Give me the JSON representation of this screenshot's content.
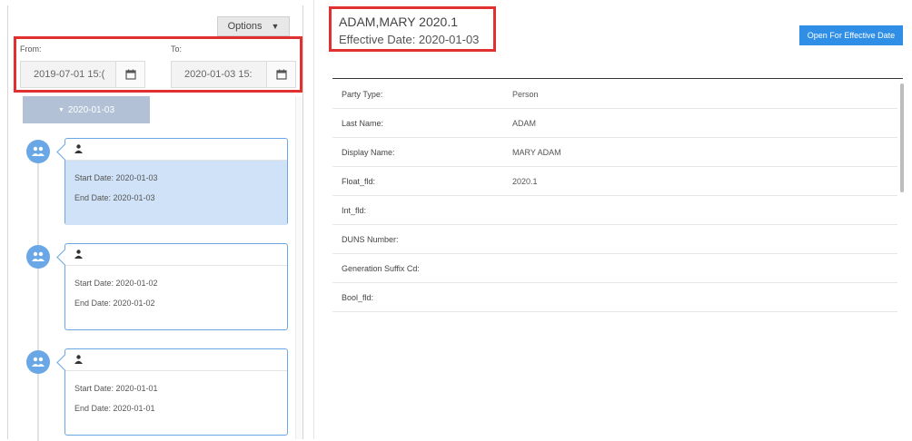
{
  "left": {
    "options_label": "Options",
    "from_label": "From:",
    "to_label": "To:",
    "from_value": "2019-07-01 15:(",
    "to_value": "2020-01-03 15:",
    "group_label": "2020-01-03",
    "cards": [
      {
        "start": "Start Date: 2020-01-03",
        "end": "End Date: 2020-01-03",
        "selected": true
      },
      {
        "start": "Start Date: 2020-01-02",
        "end": "End Date: 2020-01-02",
        "selected": false
      },
      {
        "start": "Start Date: 2020-01-01",
        "end": "End Date: 2020-01-01",
        "selected": false
      }
    ]
  },
  "header": {
    "title": "ADAM,MARY 2020.1",
    "effective": "Effective Date:  2020-01-03",
    "open_button": "Open For Effective Date"
  },
  "fields": [
    {
      "label": "Party Type:",
      "value": "Person"
    },
    {
      "label": "Last Name:",
      "value": "ADAM"
    },
    {
      "label": "Display Name:",
      "value": "MARY ADAM"
    },
    {
      "label": "Float_fld:",
      "value": "2020.1"
    },
    {
      "label": "Int_fld:",
      "value": ""
    },
    {
      "label": "DUNS Number:",
      "value": ""
    },
    {
      "label": "Generation Suffix Cd:",
      "value": ""
    },
    {
      "label": "Bool_fld:",
      "value": ""
    }
  ],
  "colors": {
    "accent": "#2f8fe6",
    "highlight": "#e03030",
    "selected": "#cfe2f7"
  },
  "icons": {
    "calendar": "calendar-icon",
    "person": "person-icon",
    "group": "people-icon",
    "caret": "caret-down-icon"
  }
}
